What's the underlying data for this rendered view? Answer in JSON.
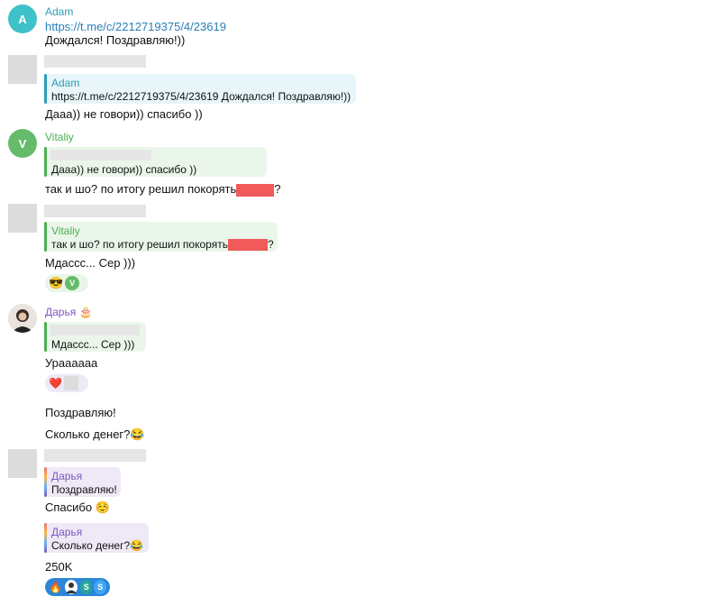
{
  "messages": {
    "m1": {
      "avatar_letter": "A",
      "name": "Adam",
      "link": "https://t.me/c/2212719375/4/23619",
      "text": "Дождался! Поздравляю!))"
    },
    "m2": {
      "quote_name": "Adam",
      "quote_text": "https://t.me/c/2212719375/4/23619 Дождался! Поздравляю!))",
      "text": "Дааа)) не говори)) спасибо ))"
    },
    "m3": {
      "avatar_letter": "V",
      "name": "Vitaliy",
      "quote_text": "Дааа)) не говори)) спасибо ))",
      "text": "так и шо? по итогу решил покорять",
      "text_end": "?"
    },
    "m4": {
      "quote_name": "Vitaliy",
      "quote_text": "так и шо? по итогу решил покорять",
      "quote_end": "?",
      "text": "Мдассс... Сер )))",
      "reaction_emoji": "😎",
      "reaction_avatar": "V"
    },
    "m5": {
      "name": "Дарья",
      "name_badge": "🎂",
      "quote_text": "Мдассс... Сер )))",
      "text": "Ураааааа",
      "reaction_emoji": "❤️",
      "text2": "Поздравляю!",
      "text3": "Сколько денег?😂"
    },
    "m6": {
      "quote1_name": "Дарья",
      "quote1_text": "Поздравляю!",
      "text": "Спасибо ☺️",
      "quote2_name": "Дарья",
      "quote2_text": "Сколько денег?😂",
      "text2": "250K",
      "reaction_emoji": "🔥",
      "reaction_s1": "S",
      "reaction_s2": "S"
    }
  },
  "colors": {
    "adam": "#2a9fb8",
    "vitaliy": "#4caf50",
    "darya": "#7e57c2",
    "link": "#2a7fb8",
    "reaction_blue": "#2b86d9"
  }
}
